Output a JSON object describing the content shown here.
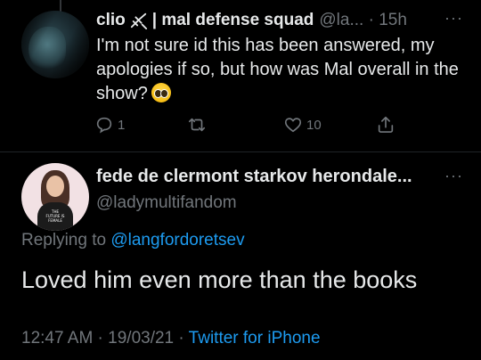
{
  "reply_tweet": {
    "display_name": "clio",
    "name_suffix": "| mal defense squad",
    "handle": "@la...",
    "time": "· 15h",
    "more": "···",
    "text": "I'm not sure id this has been answered, my apologies if so, but how was Mal overall in the show?",
    "emoji": "pleading-face-emoji",
    "actions": {
      "reply_count": "1",
      "retweet_count": "",
      "like_count": "10"
    }
  },
  "main_tweet": {
    "display_name": "fede de clermont starkov herondale...",
    "handle": "@ladymultifandom",
    "more": "···",
    "avatar_shirt_text": "THE FUTURE IS FEMALE",
    "replying_prefix": "Replying to",
    "replying_to": "@langfordoretsev",
    "text": "Loved him even more than the books",
    "meta_time": "12:47 AM · 19/03/21 ·",
    "meta_source": "Twitter for iPhone"
  },
  "colors": {
    "background": "#000000",
    "primary_text": "#e7e9ea",
    "secondary_text": "#71767b",
    "link": "#1d9bf0"
  }
}
